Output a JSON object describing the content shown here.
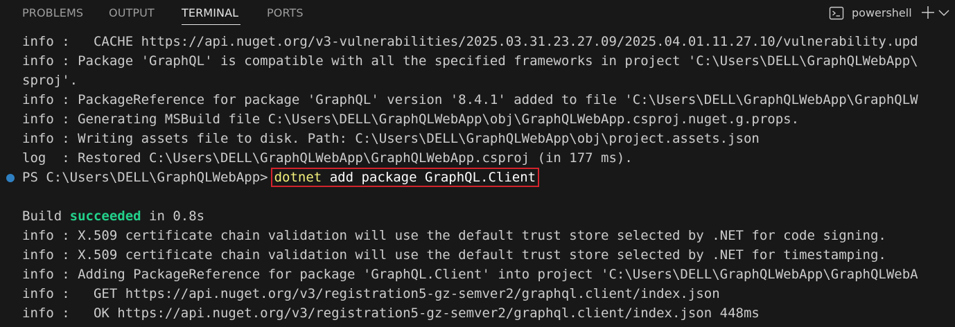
{
  "panel_tabs": [
    {
      "label": "PROBLEMS"
    },
    {
      "label": "OUTPUT"
    },
    {
      "label": "TERMINAL"
    },
    {
      "label": "PORTS"
    }
  ],
  "active_tab": "TERMINAL",
  "toolbar": {
    "shell_name": "powershell",
    "new_terminal_icon": "plus-icon",
    "dropdown_icon": "chevron-down-icon",
    "shell_icon": "terminal-icon"
  },
  "colors": {
    "background": "#181818",
    "text": "#cccccc",
    "command_executable": "#f1ef7a",
    "success": "#23d18b",
    "highlight_box": "#d3232c",
    "prompt_dot": "#2f80c2"
  },
  "terminal": {
    "lines_before": [
      "info :   CACHE https://api.nuget.org/v3-vulnerabilities/2025.03.31.23.27.09/2025.04.01.11.27.10/vulnerability.upd",
      "info : Package 'GraphQL' is compatible with all the specified frameworks in project 'C:\\Users\\DELL\\GraphQLWebApp\\",
      "sproj'.",
      "info : PackageReference for package 'GraphQL' version '8.4.1' added to file 'C:\\Users\\DELL\\GraphQLWebApp\\GraphQLW",
      "info : Generating MSBuild file C:\\Users\\DELL\\GraphQLWebApp\\obj\\GraphQLWebApp.csproj.nuget.g.props.",
      "info : Writing assets file to disk. Path: C:\\Users\\DELL\\GraphQLWebApp\\obj\\project.assets.json",
      "log  : Restored C:\\Users\\DELL\\GraphQLWebApp\\GraphQLWebApp.csproj (in 177 ms)."
    ],
    "prompt": "PS C:\\Users\\DELL\\GraphQLWebApp>",
    "command_executable": "dotnet",
    "command_args": " add package GraphQL.Client",
    "build_prefix": "Build ",
    "build_status": "succeeded",
    "build_suffix": " in 0.8s",
    "lines_after": [
      "info : X.509 certificate chain validation will use the default trust store selected by .NET for code signing.",
      "info : X.509 certificate chain validation will use the default trust store selected by .NET for timestamping.",
      "info : Adding PackageReference for package 'GraphQL.Client' into project 'C:\\Users\\DELL\\GraphQLWebApp\\GraphQLWebA",
      "info :   GET https://api.nuget.org/v3/registration5-gz-semver2/graphql.client/index.json",
      "info :   OK https://api.nuget.org/v3/registration5-gz-semver2/graphql.client/index.json 448ms"
    ]
  }
}
